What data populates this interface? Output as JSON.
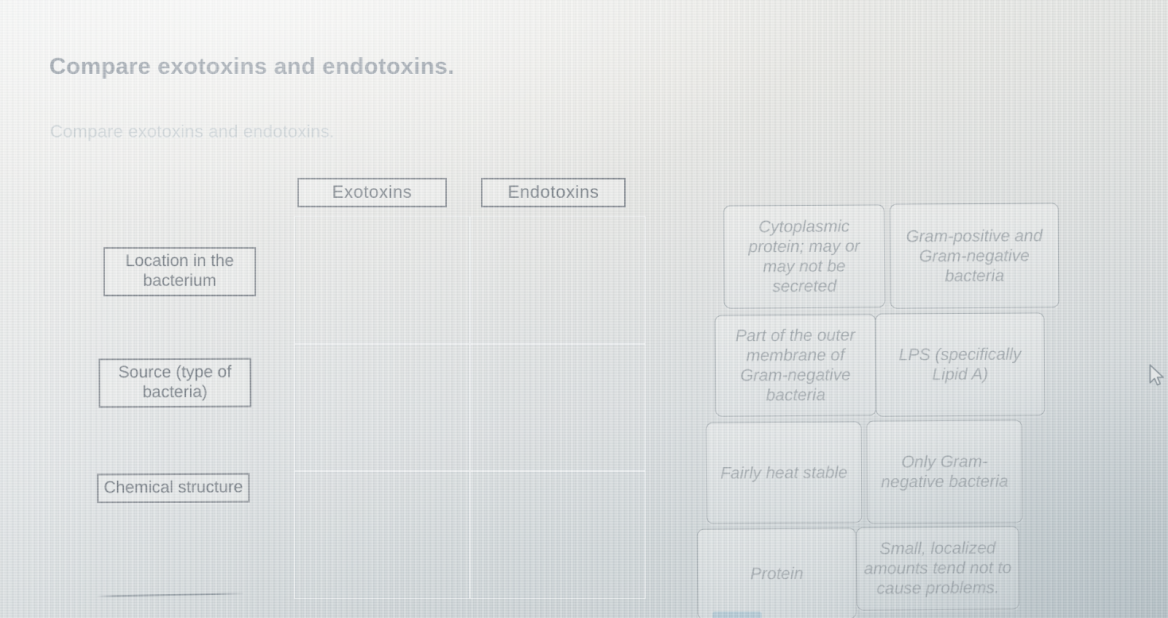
{
  "page": {
    "title": "Compare exotoxins and endotoxins.",
    "subtitle": "Compare exotoxins and endotoxins."
  },
  "matrix": {
    "column_headers": [
      {
        "label": "Exotoxins"
      },
      {
        "label": "Endotoxins"
      }
    ],
    "row_labels": [
      {
        "label": "Location in the bacterium"
      },
      {
        "label": "Source (type of bacteria)"
      },
      {
        "label": "Chemical structure"
      }
    ],
    "drop_zones": [
      {
        "row": "Location in the bacterium",
        "column": "Exotoxins",
        "value": ""
      },
      {
        "row": "Location in the bacterium",
        "column": "Endotoxins",
        "value": ""
      },
      {
        "row": "Source (type of bacteria)",
        "column": "Exotoxins",
        "value": ""
      },
      {
        "row": "Source (type of bacteria)",
        "column": "Endotoxins",
        "value": ""
      },
      {
        "row": "Chemical structure",
        "column": "Exotoxins",
        "value": ""
      },
      {
        "row": "Chemical structure",
        "column": "Endotoxins",
        "value": ""
      }
    ]
  },
  "answer_bank": {
    "tiles": [
      {
        "label": "Cytoplasmic protein; may or may not be secreted"
      },
      {
        "label": "Gram-positive and Gram-negative bacteria"
      },
      {
        "label": "Part of the outer membrane of Gram-negative bacteria"
      },
      {
        "label": "LPS (specifically Lipid A)"
      },
      {
        "label": "Fairly heat stable"
      },
      {
        "label": "Only Gram-negative bacteria"
      },
      {
        "label": "Protein"
      },
      {
        "label": "Small, localized amounts tend not to cause problems."
      }
    ]
  },
  "cursor": {
    "icon": "arrow-pointer-cursor"
  },
  "colors": {
    "title_text": "#5f6b78",
    "subtitle_text": "#b9c2c6",
    "chip_border": "#6a7078",
    "chip_text": "#545c65",
    "tile_border": "#8e979c",
    "tile_text": "#8d959a",
    "background_top": "#f2f1ec",
    "background_bottom": "#c3cbce"
  }
}
